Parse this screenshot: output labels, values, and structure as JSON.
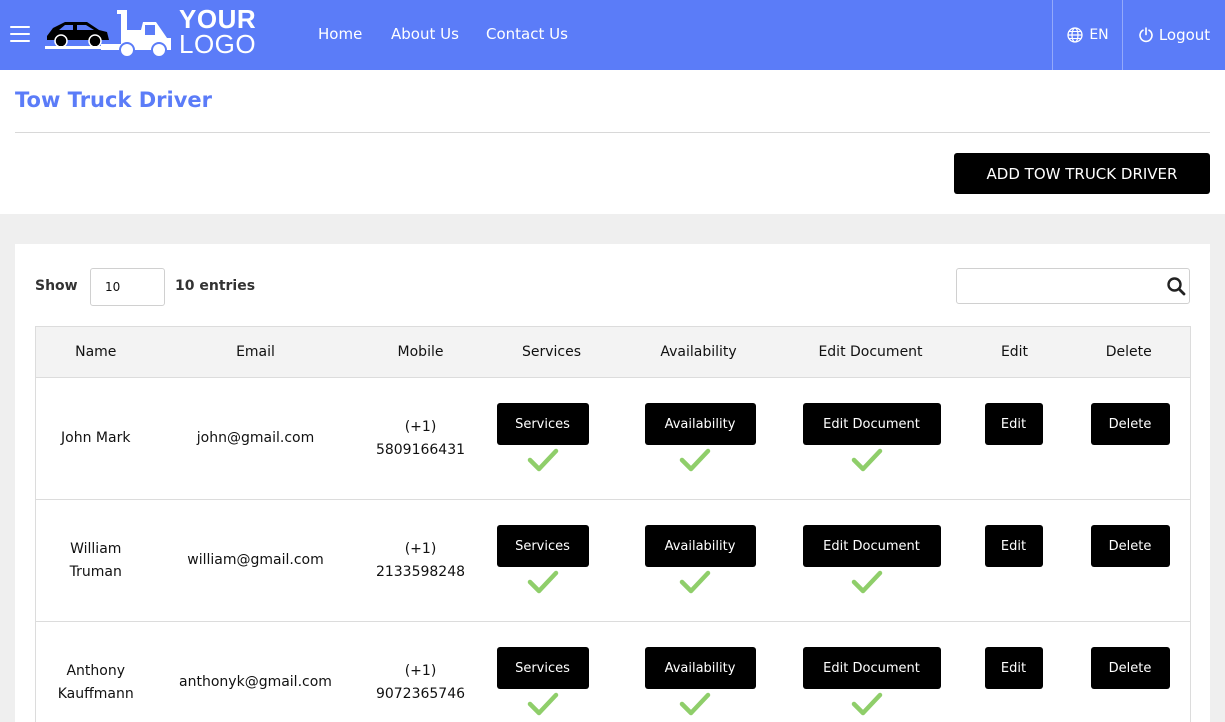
{
  "header": {
    "logo_line1": "YOUR",
    "logo_line2": "LOGO",
    "nav": [
      "Home",
      "About Us",
      "Contact Us"
    ],
    "language": "EN",
    "logout": "Logout",
    "bar_color": "#5b7cf8"
  },
  "page": {
    "title": "Tow Truck Driver",
    "add_button": "ADD TOW TRUCK DRIVER"
  },
  "table_controls": {
    "show_label": "Show",
    "page_size": "10",
    "entries_label": "10 entries",
    "search_value": ""
  },
  "table": {
    "columns": [
      "Name",
      "Email",
      "Mobile",
      "Services",
      "Availability",
      "Edit Document",
      "Edit",
      "Delete"
    ],
    "rows": [
      {
        "name": "John Mark",
        "email": "john@gmail.com",
        "mobile_code": "(+1)",
        "mobile_number": "5809166431",
        "services": "Services",
        "availability": "Availability",
        "edit_document": "Edit Document",
        "edit": "Edit",
        "delete": "Delete"
      },
      {
        "name": "William Truman",
        "email": "william@gmail.com",
        "mobile_code": "(+1)",
        "mobile_number": "2133598248",
        "services": "Services",
        "availability": "Availability",
        "edit_document": "Edit Document",
        "edit": "Edit",
        "delete": "Delete"
      },
      {
        "name": "Anthony Kauffmann",
        "email": "anthonyk@gmail.com",
        "mobile_code": "(+1)",
        "mobile_number": "9072365746",
        "services": "Services",
        "availability": "Availability",
        "edit_document": "Edit Document",
        "edit": "Edit",
        "delete": "Delete"
      }
    ],
    "check_color": "#8fce6a"
  }
}
